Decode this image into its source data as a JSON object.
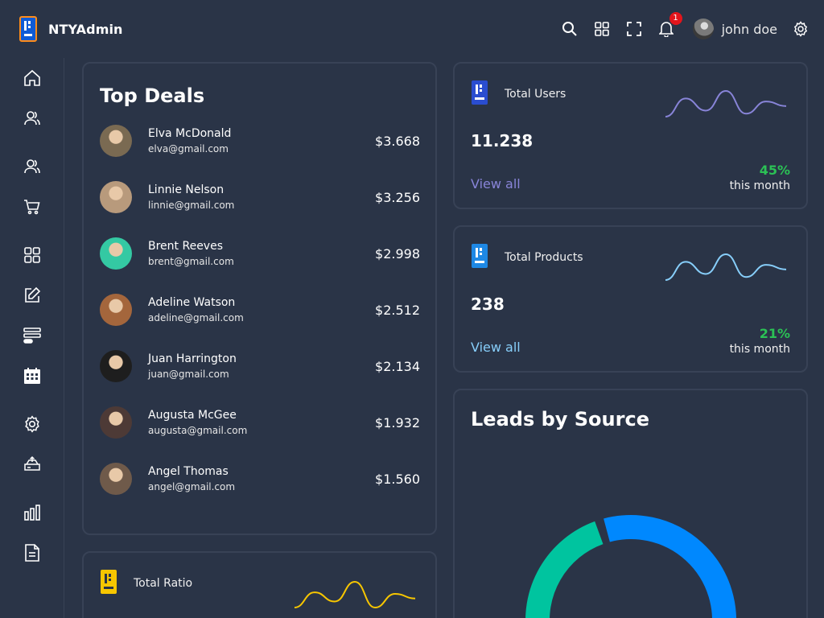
{
  "app": {
    "title": "NTYAdmin"
  },
  "header": {
    "notification_count": "1",
    "user_name": "john doe",
    "icons": [
      "search-icon",
      "apps-icon",
      "fullscreen-icon",
      "bell-icon",
      "settings-icon"
    ]
  },
  "sidebar": {
    "items": [
      {
        "icon": "home-icon"
      },
      {
        "icon": "profile-icon"
      },
      {
        "icon": "users-icon"
      },
      {
        "icon": "cart-icon"
      },
      {
        "icon": "grid-icon"
      },
      {
        "icon": "edit-icon"
      },
      {
        "icon": "list-icon"
      },
      {
        "icon": "calendar-icon"
      },
      {
        "icon": "settings-icon"
      },
      {
        "icon": "backup-icon"
      },
      {
        "icon": "charts-icon"
      },
      {
        "icon": "logs-icon"
      }
    ]
  },
  "top_deals": {
    "title": "Top Deals",
    "deals": [
      {
        "name": "Elva McDonald",
        "email": "elva@gmail.com",
        "amount": "$3.668",
        "color": "#7a6a52"
      },
      {
        "name": "Linnie Nelson",
        "email": "linnie@gmail.com",
        "amount": "$3.256",
        "color": "#b89a7c"
      },
      {
        "name": "Brent Reeves",
        "email": "brent@gmail.com",
        "amount": "$2.998",
        "color": "#34c9a3"
      },
      {
        "name": "Adeline Watson",
        "email": "adeline@gmail.com",
        "amount": "$2.512",
        "color": "#a4663c"
      },
      {
        "name": "Juan Harrington",
        "email": "juan@gmail.com",
        "amount": "$2.134",
        "color": "#1e1e1e"
      },
      {
        "name": "Augusta McGee",
        "email": "augusta@gmail.com",
        "amount": "$1.932",
        "color": "#4d3a36"
      },
      {
        "name": "Angel Thomas",
        "email": "angel@gmail.com",
        "amount": "$1.560",
        "color": "#6f5a4a"
      }
    ]
  },
  "stats": [
    {
      "title": "Total Users",
      "value": "11.238",
      "link": "View all",
      "percent": "45%",
      "period": "this month",
      "color": "#8884d8",
      "trend": [
        22,
        10,
        18,
        5,
        20,
        12,
        15
      ]
    },
    {
      "title": "Total Products",
      "value": "238",
      "link": "View all",
      "percent": "21%",
      "period": "this month",
      "color": "#87cefa",
      "trend": [
        22,
        10,
        18,
        5,
        20,
        12,
        15
      ]
    }
  ],
  "total_ratio": {
    "title": "Total Ratio",
    "color": "#f7c600",
    "trend": [
      22,
      12,
      18,
      5,
      22,
      13,
      16
    ]
  },
  "leads": {
    "title": "Leads by Source",
    "segments": [
      {
        "color": "#0088fe",
        "value": 40
      },
      {
        "color": "#00c49f",
        "value": 20
      }
    ]
  }
}
